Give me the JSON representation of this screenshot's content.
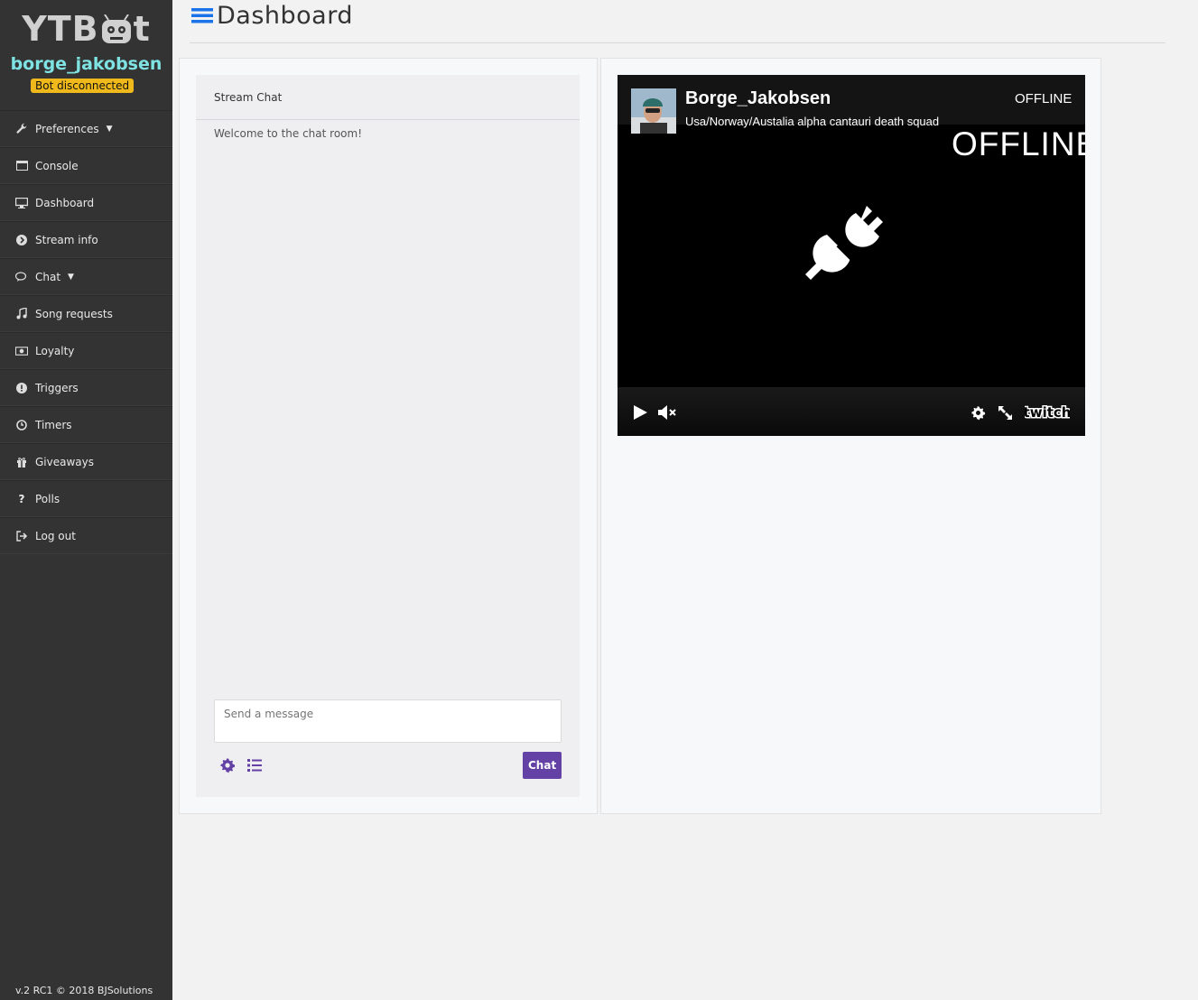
{
  "sidebar": {
    "logo": "YTB",
    "logo_suffix": "t",
    "username": "borge_jakobsen",
    "status": "Bot disconnected",
    "items": [
      {
        "label": "Preferences",
        "icon": "wrench-icon",
        "dropdown": true
      },
      {
        "label": "Console",
        "icon": "window-icon",
        "dropdown": false
      },
      {
        "label": "Dashboard",
        "icon": "monitor-icon",
        "dropdown": false
      },
      {
        "label": "Stream info",
        "icon": "chevron-circle-icon",
        "dropdown": false
      },
      {
        "label": "Chat",
        "icon": "comments-icon",
        "dropdown": true
      },
      {
        "label": "Song requests",
        "icon": "music-icon",
        "dropdown": false
      },
      {
        "label": "Loyalty",
        "icon": "money-icon",
        "dropdown": false
      },
      {
        "label": "Triggers",
        "icon": "exclamation-icon",
        "dropdown": false
      },
      {
        "label": "Timers",
        "icon": "clock-icon",
        "dropdown": false
      },
      {
        "label": "Giveaways",
        "icon": "gift-icon",
        "dropdown": false
      },
      {
        "label": "Polls",
        "icon": "question-icon",
        "dropdown": false
      },
      {
        "label": "Log out",
        "icon": "sign-out-icon",
        "dropdown": false
      }
    ],
    "footer": "v.2 RC1 © 2018 BJSolutions"
  },
  "header": {
    "title": "Dashboard"
  },
  "chat": {
    "title": "Stream Chat",
    "welcome": "Welcome to the chat room!",
    "input_placeholder": "Send a message",
    "send_label": "Chat",
    "accent": "#6441a4"
  },
  "player": {
    "channel": "Borge_Jakobsen",
    "stream_title": "Usa/Norway/Austalia alpha cantauri death squad",
    "status_small": "OFFLINE",
    "status_big": "OFFLINE",
    "brand": "twitch"
  }
}
